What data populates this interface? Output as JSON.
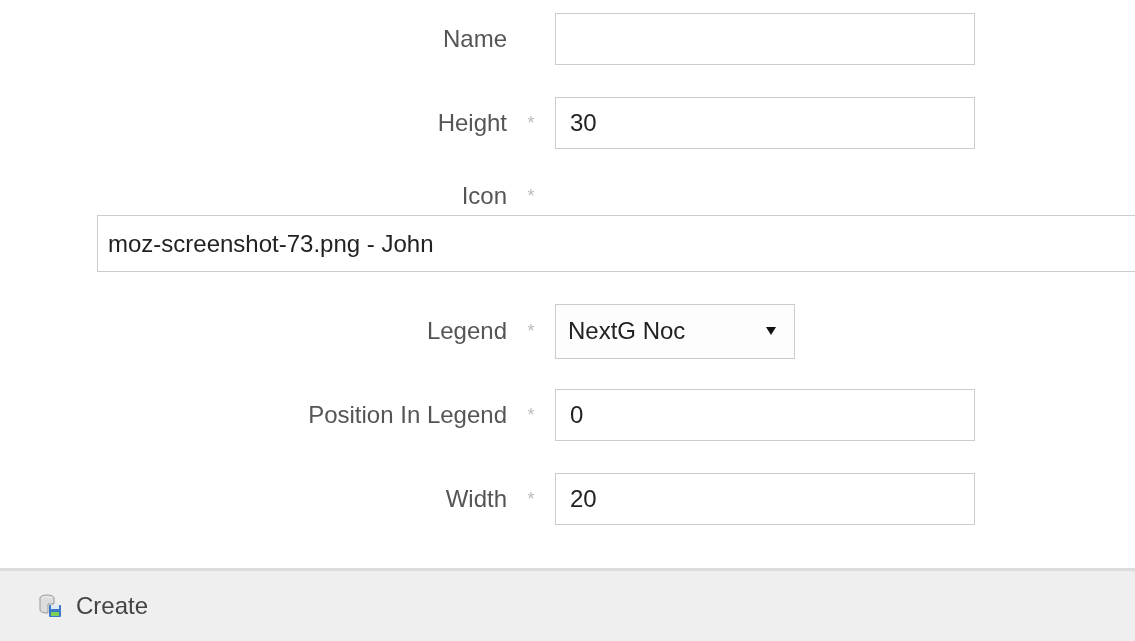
{
  "form": {
    "fields": [
      {
        "kind": "text",
        "label": "Name"
      },
      {
        "kind": "text",
        "label": "Height",
        "mark": "*",
        "value": "30"
      },
      {
        "kind": "wide",
        "label": "Icon",
        "mark": "*",
        "value": "moz-screenshot-73.png - John"
      },
      {
        "kind": "select",
        "label": "Legend",
        "mark": "*",
        "value": "NextG Noc"
      },
      {
        "kind": "text",
        "label": "Position In Legend",
        "mark": "*",
        "value": "0"
      },
      {
        "kind": "text",
        "label": "Width",
        "mark": "*",
        "value": "20"
      }
    ]
  },
  "footer": {
    "button": "Create"
  }
}
